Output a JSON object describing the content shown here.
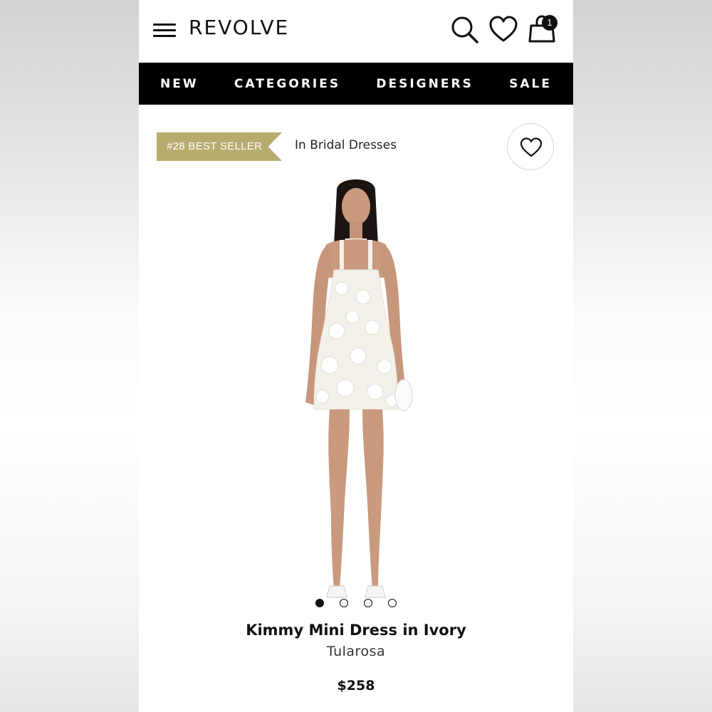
{
  "header": {
    "logo": "REVOLVE",
    "cart_count": "1",
    "icons": [
      "menu-icon",
      "search-icon",
      "heart-icon",
      "shopping-bag-icon"
    ]
  },
  "nav": {
    "items": [
      {
        "label": "NEW"
      },
      {
        "label": "CATEGORIES"
      },
      {
        "label": "DESIGNERS"
      },
      {
        "label": "SALE"
      }
    ]
  },
  "badge": {
    "rank_label": "#28 BEST SELLER",
    "category_label": "In Bridal Dresses",
    "accent_color": "#b8ab6e"
  },
  "carousel": {
    "active_index": 0,
    "total": 4
  },
  "product": {
    "name": "Kimmy Mini Dress in Ivory",
    "brand": "Tularosa",
    "price": "$258"
  }
}
